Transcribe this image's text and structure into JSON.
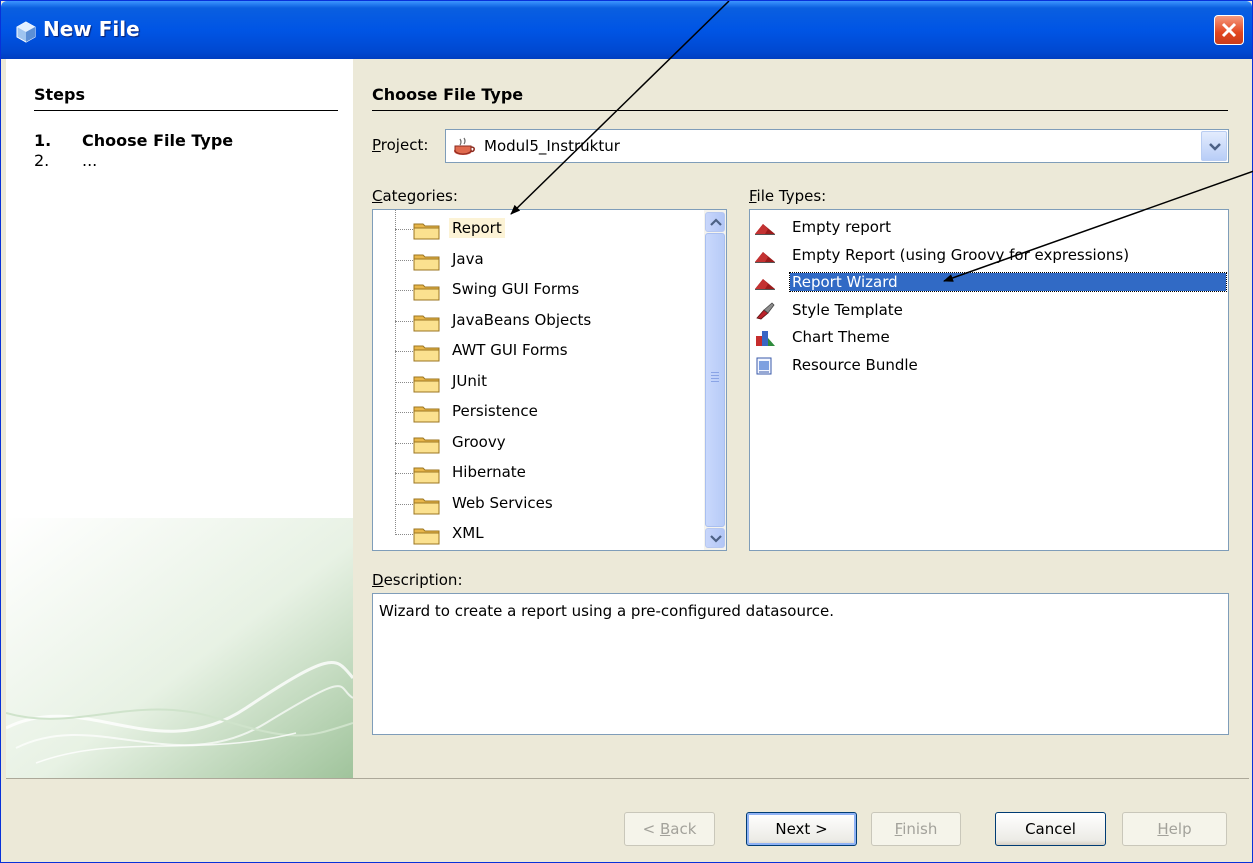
{
  "window": {
    "title": "New File"
  },
  "steps": {
    "header": "Steps",
    "items": [
      {
        "num": "1.",
        "label": "Choose File Type"
      },
      {
        "num": "2.",
        "label": "..."
      }
    ]
  },
  "main": {
    "header": "Choose File Type",
    "project_label_mn": "P",
    "project_label_rest": "roject:",
    "project_value": "Modul5_Instruktur",
    "categories_label_mn": "C",
    "categories_label_rest": "ategories:",
    "filetypes_label_mn": "F",
    "filetypes_label_rest": "ile Types:",
    "description_label_mn": "D",
    "description_label_rest": "escription:",
    "categories": [
      {
        "label": "Report"
      },
      {
        "label": "Java"
      },
      {
        "label": "Swing GUI Forms"
      },
      {
        "label": "JavaBeans Objects"
      },
      {
        "label": "AWT GUI Forms"
      },
      {
        "label": "JUnit"
      },
      {
        "label": "Persistence"
      },
      {
        "label": "Groovy"
      },
      {
        "label": "Hibernate"
      },
      {
        "label": "Web Services"
      },
      {
        "label": "XML"
      }
    ],
    "file_types": [
      {
        "label": "Empty report",
        "icon": "report-icon"
      },
      {
        "label": "Empty Report (using Groovy for expressions)",
        "icon": "report-icon"
      },
      {
        "label": "Report Wizard",
        "icon": "report-icon"
      },
      {
        "label": "Style Template",
        "icon": "style-template-icon"
      },
      {
        "label": "Chart Theme",
        "icon": "chart-theme-icon"
      },
      {
        "label": "Resource Bundle",
        "icon": "resource-bundle-icon"
      }
    ],
    "selected_category": "Report",
    "selected_file_type": "Report Wizard",
    "description": "Wizard to create a report using a pre-configured datasource."
  },
  "buttons": {
    "back_pre": "< ",
    "back_mn": "B",
    "back_rest": "ack",
    "next": "Next >",
    "finish_mn": "F",
    "finish_rest": "inish",
    "cancel": "Cancel",
    "help_mn": "H",
    "help_rest": "elp"
  },
  "colors": {
    "title_bar": "#0055e5",
    "selection": "#316ac5",
    "category_highlight": "#fcf3d6"
  }
}
